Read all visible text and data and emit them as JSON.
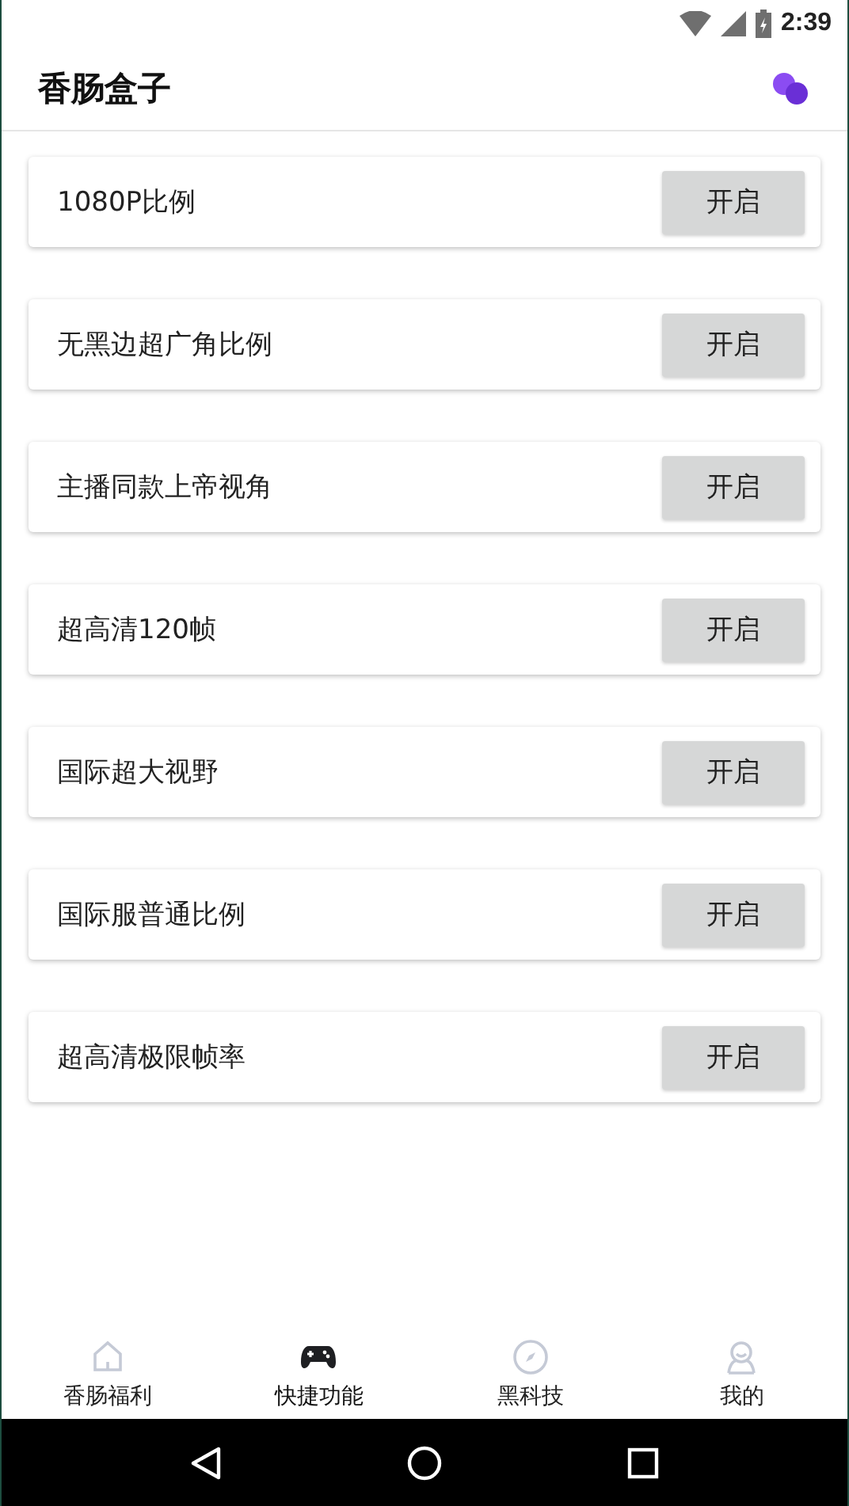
{
  "status_bar": {
    "time": "2:39"
  },
  "app_bar": {
    "title": "香肠盒子"
  },
  "options": [
    {
      "label": "1080P比例",
      "button": "开启"
    },
    {
      "label": "无黑边超广角比例",
      "button": "开启"
    },
    {
      "label": "主播同款上帝视角",
      "button": "开启"
    },
    {
      "label": "超高清120帧",
      "button": "开启"
    },
    {
      "label": "国际超大视野",
      "button": "开启"
    },
    {
      "label": "国际服普通比例",
      "button": "开启"
    },
    {
      "label": "超高清极限帧率",
      "button": "开启"
    }
  ],
  "tabs": [
    {
      "label": "香肠福利",
      "kind": "home",
      "selected": false
    },
    {
      "label": "快捷功能",
      "kind": "game",
      "selected": true
    },
    {
      "label": "黑科技",
      "kind": "compass",
      "selected": false
    },
    {
      "label": "我的",
      "kind": "user",
      "selected": false
    }
  ]
}
